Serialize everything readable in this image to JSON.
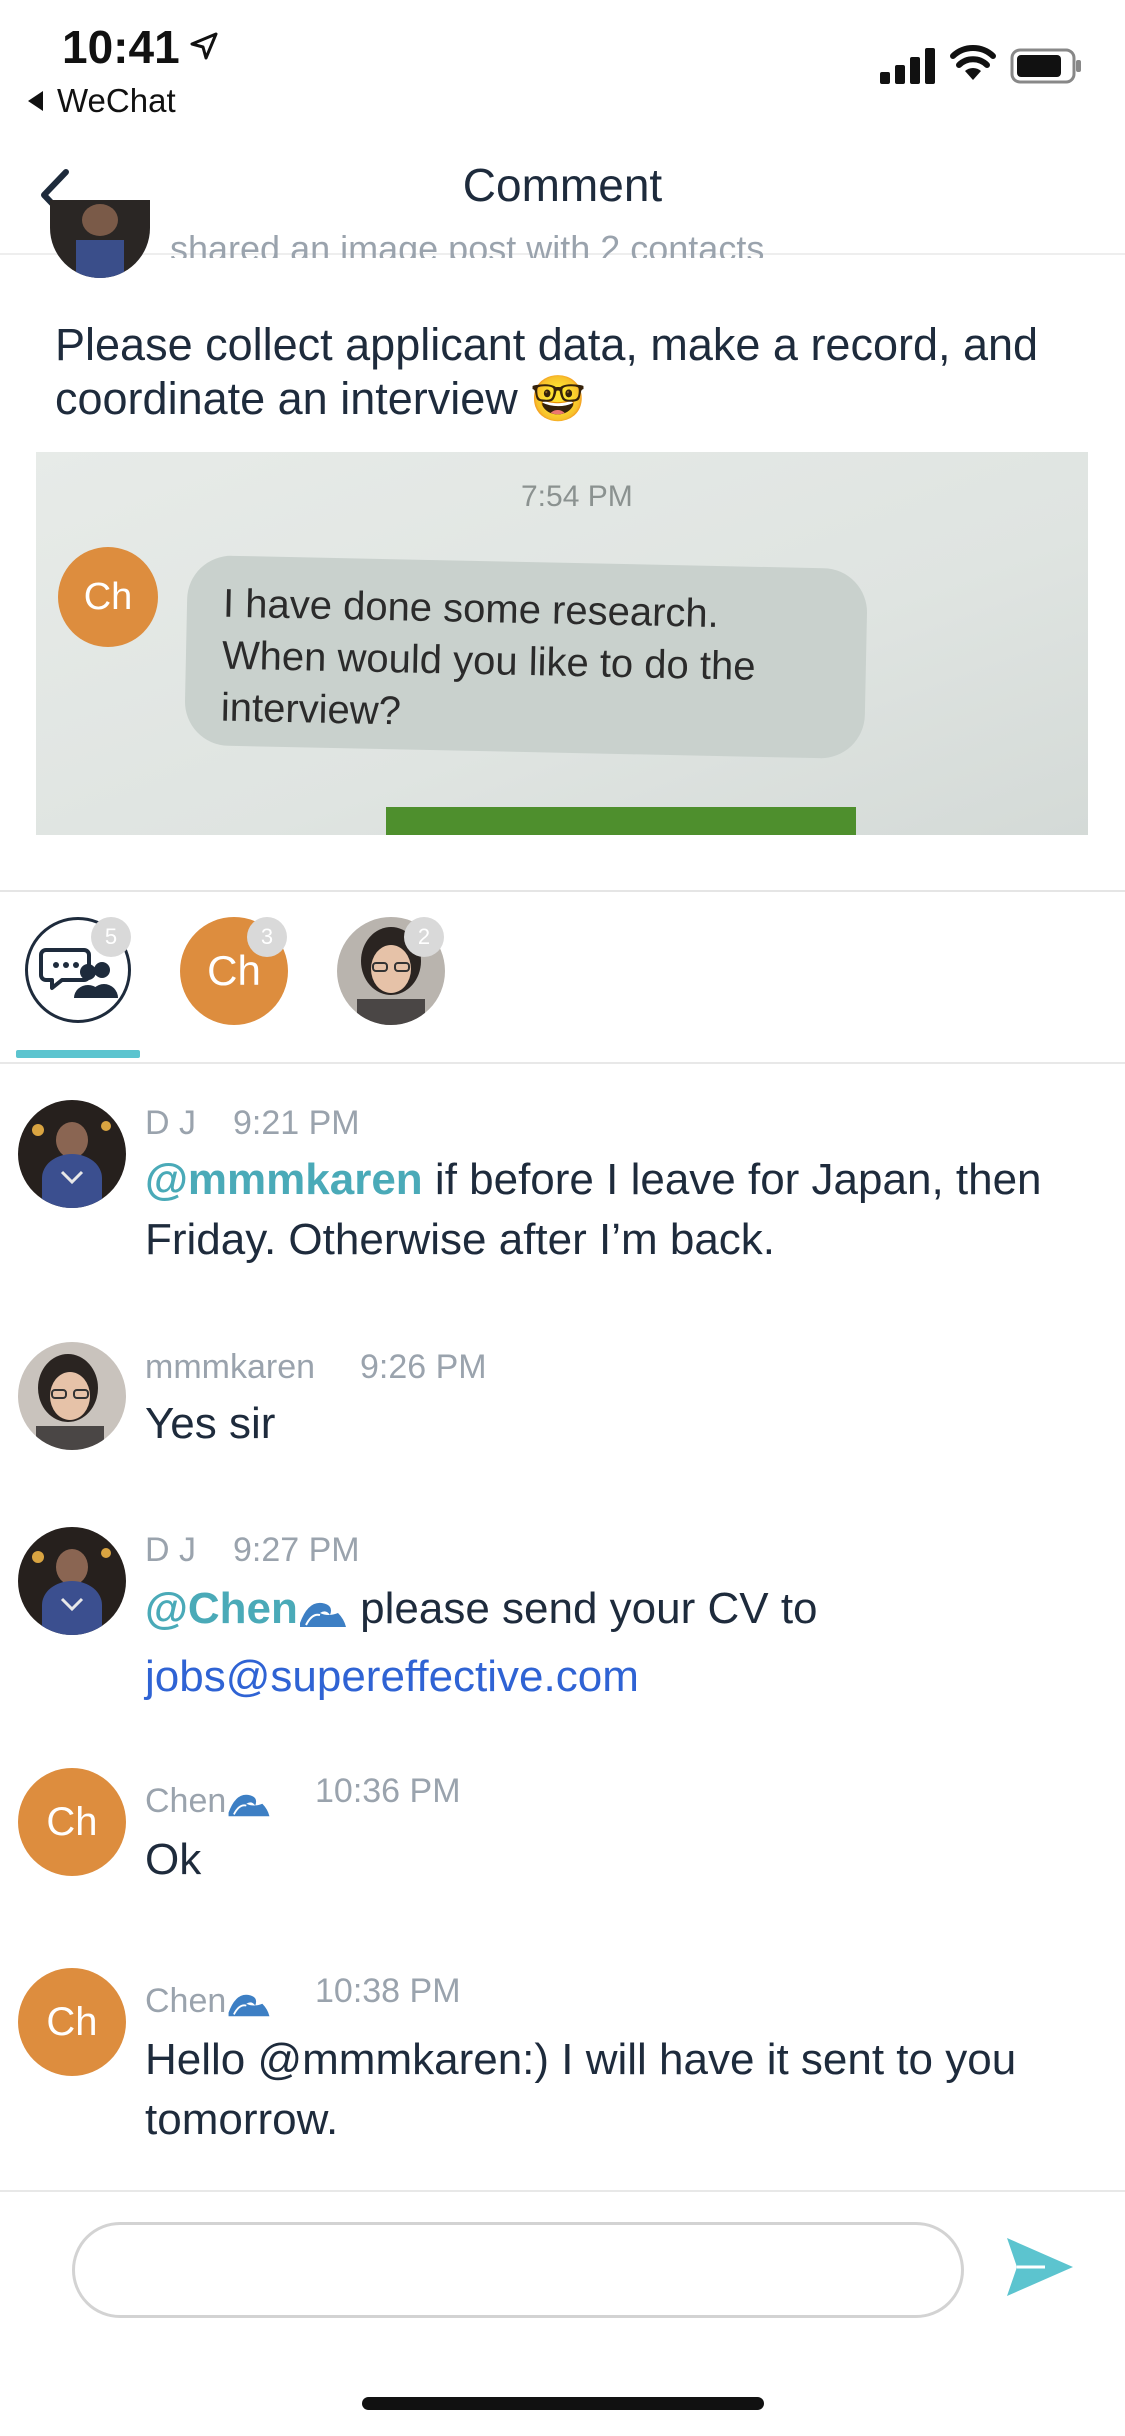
{
  "status_bar": {
    "time": "10:41",
    "back_app": "WeChat"
  },
  "nav": {
    "title": "Comment"
  },
  "post": {
    "subtitle": "shared an image post with 2 contacts",
    "text": "Please collect applicant data, make a record, and coordinate an interview 🤓",
    "image": {
      "time": "7:54 PM",
      "avatar": "Ch",
      "message": "I have done some research. When would you like to do the interview?"
    }
  },
  "tabs": [
    {
      "name": "all",
      "badge": "5",
      "icon": "group-chat-icon"
    },
    {
      "name": "Chen",
      "label": "Ch",
      "badge": "3"
    },
    {
      "name": "mmmkaren",
      "badge": "2"
    }
  ],
  "comments": [
    {
      "author": "D J",
      "time": "9:21 PM",
      "mention": "@mmmkaren",
      "text": " if before I leave for Japan, then Friday.  Otherwise after I’m back."
    },
    {
      "author": "mmmkaren",
      "time": "9:26 PM",
      "text": "Yes sir"
    },
    {
      "author": "D J",
      "time": "9:27 PM",
      "mention": "@Chen",
      "text": " please send your CV to ",
      "link": "jobs@supereffective.com"
    },
    {
      "author": "Chen",
      "avatar": "Ch",
      "time": "10:36 PM",
      "text": "Ok"
    },
    {
      "author": "Chen",
      "avatar": "Ch",
      "time": "10:38 PM",
      "text": "Hello @mmmkaren:) I will have it sent to you tomorrow."
    }
  ],
  "input": {
    "value": "",
    "placeholder": ""
  },
  "colors": {
    "accent": "#5cc4cf",
    "mention": "#4aaab8",
    "link": "#2f63d4",
    "avatar_orange": "#dd8d3e",
    "text": "#1e2b3c",
    "muted": "#9aa3ad"
  }
}
